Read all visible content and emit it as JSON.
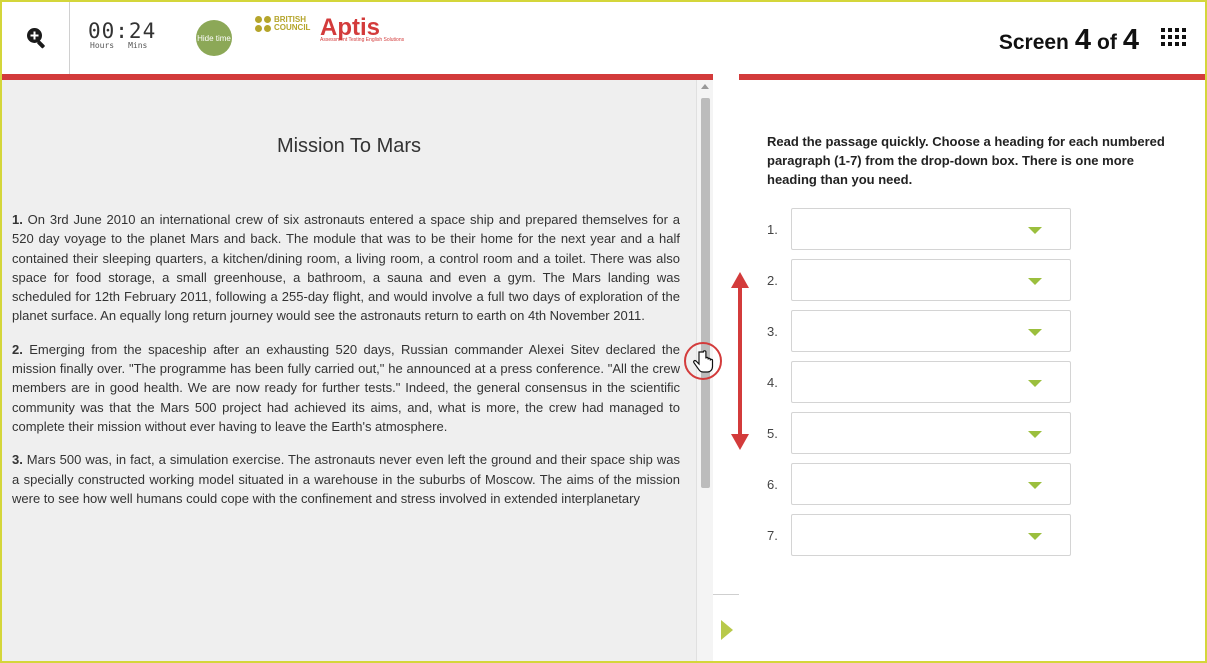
{
  "header": {
    "timer": {
      "value": "00:24",
      "hours_label": "Hours",
      "mins_label": "Mins"
    },
    "hide_time_label": "Hide time",
    "logo": {
      "british_council": "BRITISH COUNCIL",
      "aptis": "Aptis",
      "tagline": "Assessment Testing English Solutions"
    },
    "screen_indicator": {
      "prefix": "Screen",
      "current": "4",
      "of": "of",
      "total": "4"
    }
  },
  "passage": {
    "title": "Mission To Mars",
    "paragraphs": [
      {
        "num": "1.",
        "text": " On 3rd June 2010 an international crew of six astronauts entered a space ship and prepared themselves for a 520 day voyage to the planet Mars and back. The module that was to be their home for the next year and a half contained their sleeping quarters, a kitchen/dining room, a living room, a control room and a toilet. There was also space for food storage, a small greenhouse, a bathroom, a sauna and even a gym. The Mars landing was scheduled for 12th February 2011, following a 255-day flight, and would involve a full two days of exploration of the planet surface. An equally long return journey would see the astronauts return to earth on 4th November 2011."
      },
      {
        "num": "2.",
        "text": " Emerging from the spaceship after an exhausting 520 days, Russian commander Alexei Sitev declared the mission finally over. \"The programme has been fully carried out,\" he announced at a press conference. \"All the crew members are in good health. We are now ready for further tests.\" Indeed, the general consensus in the scientific community was that the Mars 500 project had achieved its aims, and, what is more, the crew had managed to complete their mission without ever having to leave the Earth's atmosphere."
      },
      {
        "num": "3.",
        "text": " Mars 500 was, in fact, a simulation exercise. The astronauts never even left the ground and their space ship was a specially constructed working model situated in a warehouse in the suburbs of Moscow. The aims of the mission were to see how well humans could cope with the confinement and stress involved in extended interplanetary"
      }
    ]
  },
  "task": {
    "instructions": "Read the passage quickly. Choose a heading for each numbered paragraph (1-7) from the drop-down box. There is one more heading than you need.",
    "questions": [
      {
        "num": "1.",
        "value": ""
      },
      {
        "num": "2.",
        "value": ""
      },
      {
        "num": "3.",
        "value": ""
      },
      {
        "num": "4.",
        "value": ""
      },
      {
        "num": "5.",
        "value": ""
      },
      {
        "num": "6.",
        "value": ""
      },
      {
        "num": "7.",
        "value": ""
      }
    ]
  },
  "colors": {
    "accent_red": "#d33b3b",
    "accent_green": "#9bbf3d",
    "frame_yellow": "#d4d63a"
  },
  "icons": {
    "zoom": "zoom-in-icon",
    "grid": "grid-menu-icon",
    "expand": "expand-panel-icon",
    "cursor": "hand-cursor-icon"
  }
}
